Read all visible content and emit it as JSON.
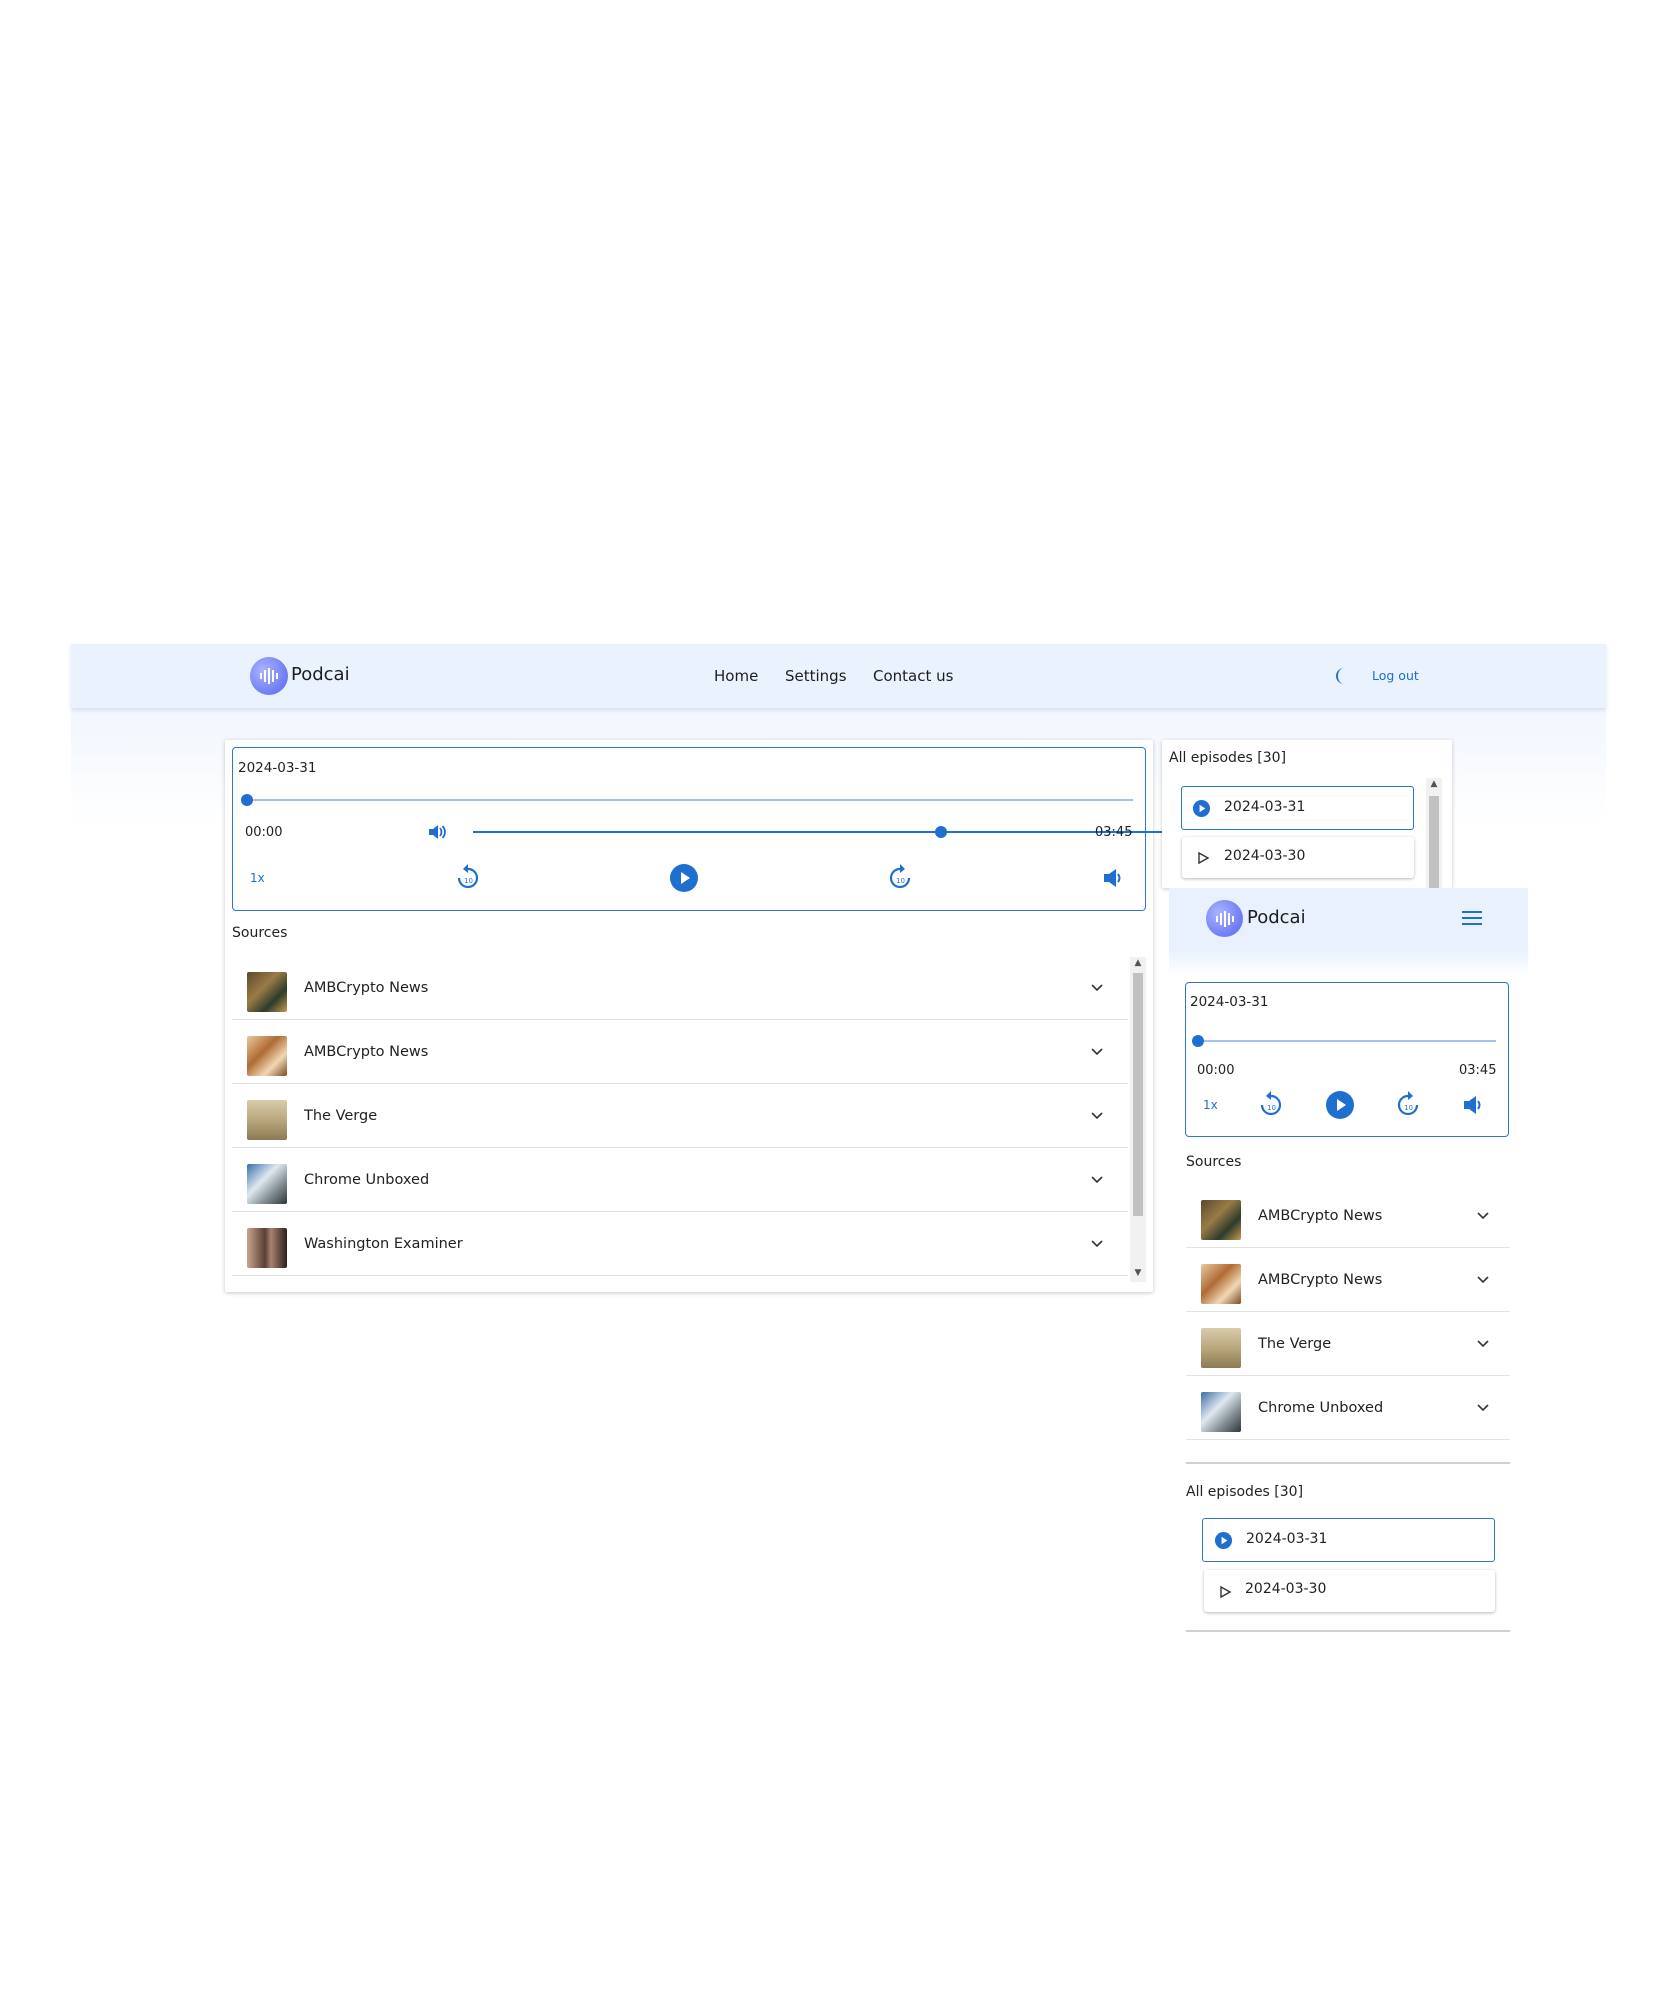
{
  "app": {
    "name": "Podcai"
  },
  "nav": {
    "home": "Home",
    "settings": "Settings",
    "contact": "Contact us",
    "logout": "Log out"
  },
  "colors": {
    "accent": "#1f6fd0",
    "header_bg": "#e9f2fd",
    "logo": "#6d7cf5"
  },
  "player": {
    "episode_title": "2024-03-31",
    "current_time": "00:00",
    "duration": "03:45",
    "speed": "1x",
    "progress": 0,
    "volume": 0.8
  },
  "sources_label": "Sources",
  "sources": [
    {
      "name": "AMBCrypto News"
    },
    {
      "name": "AMBCrypto News"
    },
    {
      "name": "The Verge"
    },
    {
      "name": "Chrome Unboxed"
    },
    {
      "name": "Washington Examiner"
    }
  ],
  "episodes_label": "All episodes [30]",
  "episodes": [
    {
      "date": "2024-03-31",
      "active": true
    },
    {
      "date": "2024-03-30",
      "active": false
    }
  ],
  "icons": {
    "logo": "waveform-icon",
    "theme": "moon-icon",
    "menu": "hamburger-icon",
    "play": "play-icon",
    "rewind": "replay-10-icon",
    "forward": "forward-10-icon",
    "volume": "volume-icon",
    "expand": "chevron-down-icon"
  }
}
